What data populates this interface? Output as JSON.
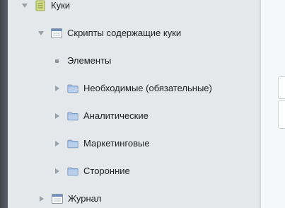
{
  "tree": {
    "root": {
      "label": "Куки",
      "icon": "document-list-icon",
      "expanded": true
    },
    "scripts": {
      "label": "Скрипты содержащие куки",
      "icon": "window-icon",
      "expanded": true
    },
    "elements": {
      "label": "Элементы"
    },
    "folders": [
      {
        "label": "Необходимые (обязательные)",
        "icon": "folder-icon"
      },
      {
        "label": "Аналитические",
        "icon": "folder-icon"
      },
      {
        "label": "Маркетинговые",
        "icon": "folder-icon"
      },
      {
        "label": "Сторонние",
        "icon": "folder-icon"
      }
    ],
    "journal": {
      "label": "Журнал",
      "icon": "window-icon",
      "expanded": false
    }
  },
  "colors": {
    "panel": "#e4e8eb",
    "folder": "#9db9dc",
    "root_icon": "#c9d67a"
  }
}
